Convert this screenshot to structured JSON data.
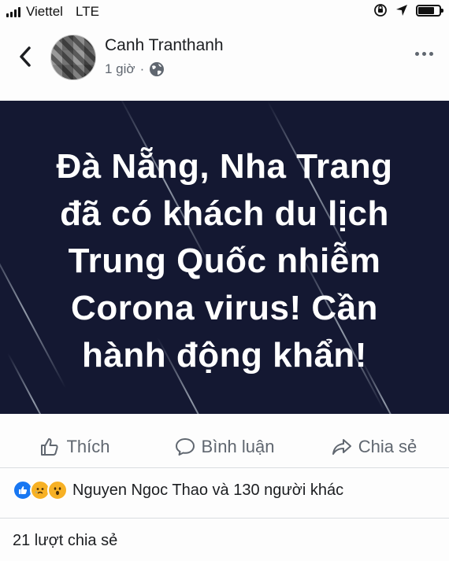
{
  "status_bar": {
    "carrier": "Viettel",
    "network": "LTE",
    "battery_level": 0.75
  },
  "header": {
    "author_name": "Canh Tranthanh",
    "timestamp": "1 giờ",
    "separator": "·",
    "privacy_icon": "globe-icon",
    "back_icon": "chevron-left-icon",
    "more_icon": "more-horizontal-icon"
  },
  "post_image": {
    "text": "Đà Nẵng, Nha Trang\nđã có khách du lịch\nTrung Quốc nhiễm\nCorona virus! Cần\nhành động khẩn!",
    "background_color": "#141832"
  },
  "actions": {
    "like": {
      "label": "Thích",
      "icon": "thumbs-up-icon"
    },
    "comment": {
      "label": "Bình luận",
      "icon": "comment-icon"
    },
    "share": {
      "label": "Chia sẻ",
      "icon": "share-icon"
    }
  },
  "reactions": {
    "icons": [
      "like-reaction",
      "sad-reaction",
      "wow-reaction"
    ],
    "summary": "Nguyen Ngoc Thao và 130 người khác"
  },
  "shares": {
    "text": "21 lượt chia sẻ"
  },
  "colors": {
    "like_blue": "#1877f2",
    "reaction_yellow": "#f7b125",
    "muted_text": "#606770"
  }
}
